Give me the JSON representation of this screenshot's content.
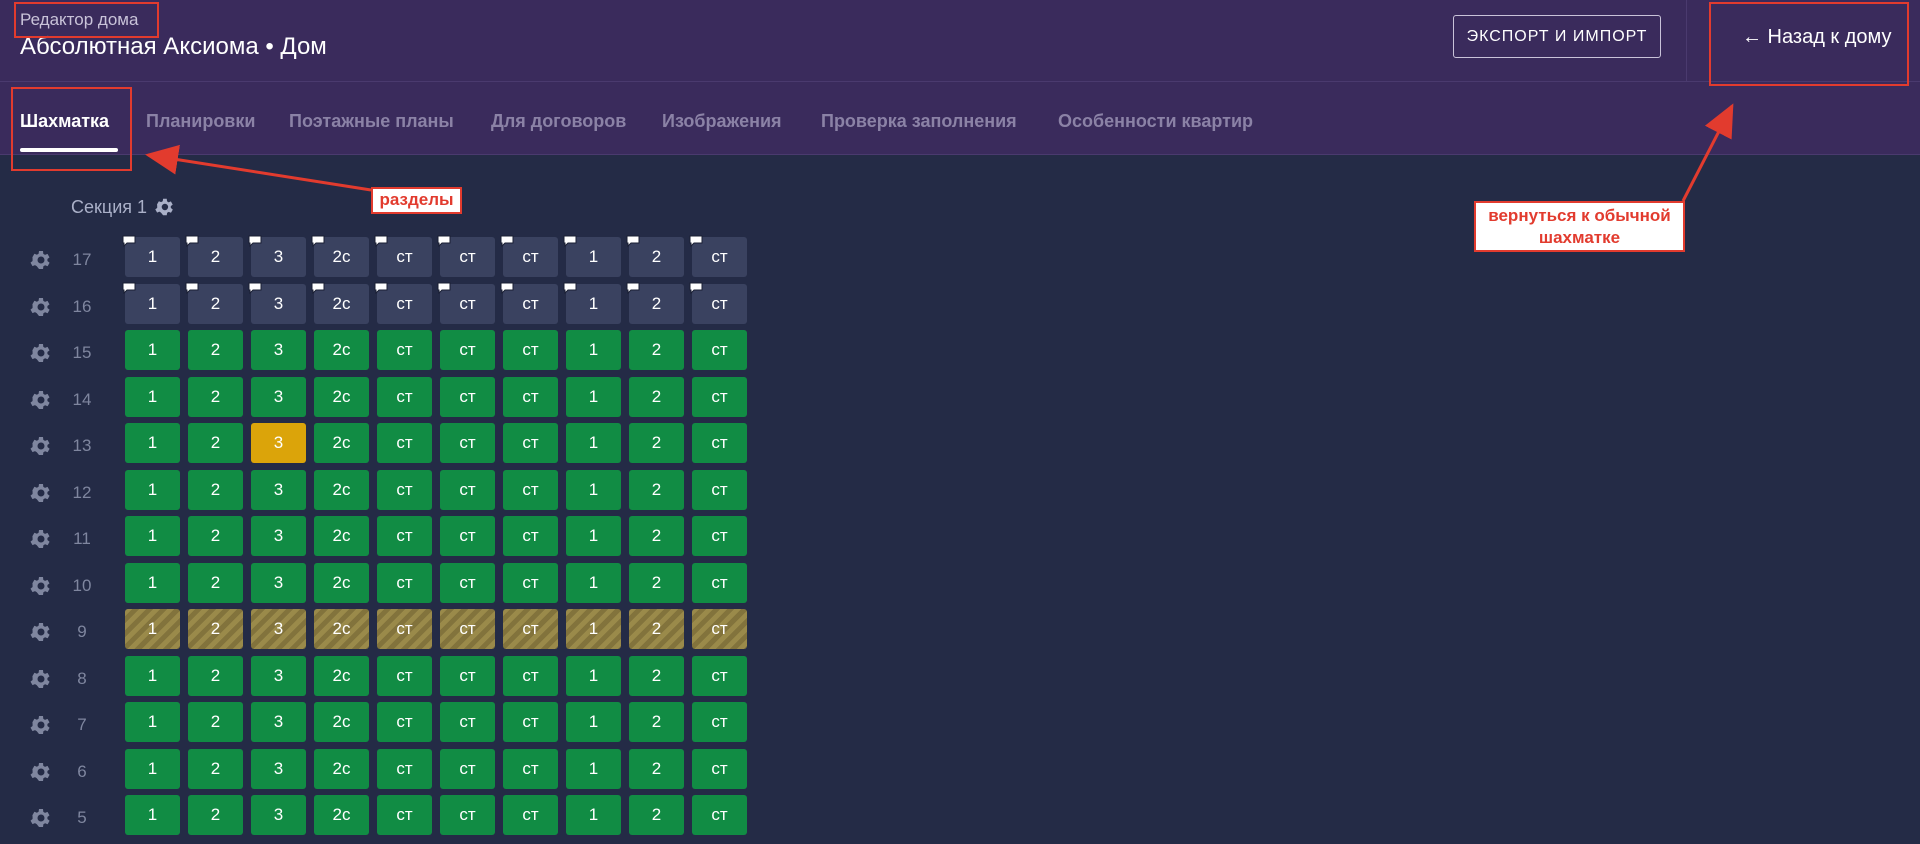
{
  "header": {
    "subtitle": "Редактор дома",
    "title": "Абсолютная Аксиома • Дом",
    "export_label": "ЭКСПОРТ И ИМПОРТ",
    "back_label": "← Назад к дому"
  },
  "tabs": [
    {
      "label": "Шахматка",
      "active": true
    },
    {
      "label": "Планировки",
      "active": false
    },
    {
      "label": "Поэтажные планы",
      "active": false
    },
    {
      "label": "Для договоров",
      "active": false
    },
    {
      "label": "Изображения",
      "active": false
    },
    {
      "label": "Проверка заполнения",
      "active": false
    },
    {
      "label": "Особенности квартир",
      "active": false
    }
  ],
  "section": {
    "label": "Секция 1",
    "icon": "gear-icon"
  },
  "apartment_types": [
    "1",
    "2",
    "3",
    "2с",
    "ст",
    "ст",
    "ст",
    "1",
    "2",
    "ст"
  ],
  "floors": [
    {
      "number": "17",
      "status": "gray",
      "comments": true
    },
    {
      "number": "16",
      "status": "gray",
      "comments": true
    },
    {
      "number": "15",
      "status": "green"
    },
    {
      "number": "14",
      "status": "green"
    },
    {
      "number": "13",
      "status": "green",
      "highlight_index": 2
    },
    {
      "number": "12",
      "status": "green"
    },
    {
      "number": "11",
      "status": "green"
    },
    {
      "number": "10",
      "status": "green"
    },
    {
      "number": "9",
      "status": "hatch"
    },
    {
      "number": "8",
      "status": "green"
    },
    {
      "number": "7",
      "status": "green"
    },
    {
      "number": "6",
      "status": "green"
    },
    {
      "number": "5",
      "status": "green"
    }
  ],
  "annotations": {
    "sections_label": "разделы",
    "back_note": "вернуться к обычной шахматке"
  },
  "colors": {
    "header_bg": "#3a2b5c",
    "page_bg": "#242b46",
    "green": "#118c44",
    "gray": "#3a4260",
    "yellow": "#dba40a",
    "annotation_red": "#e23b2e"
  }
}
